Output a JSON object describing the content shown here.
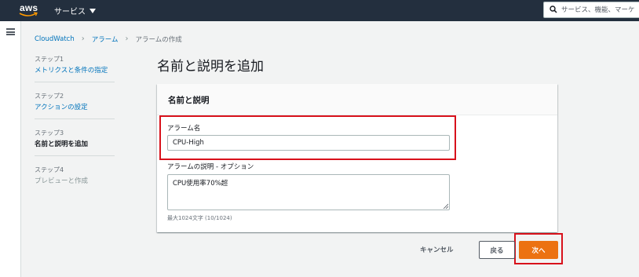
{
  "topnav": {
    "logo_text": "aws",
    "services_label": "サービス",
    "search_placeholder": "サービス、機能、マーケ"
  },
  "breadcrumb": [
    "CloudWatch",
    "アラーム",
    "アラームの作成"
  ],
  "steps": [
    {
      "num": "ステップ1",
      "label": "メトリクスと条件の指定",
      "state": "link"
    },
    {
      "num": "ステップ2",
      "label": "アクションの設定",
      "state": "link"
    },
    {
      "num": "ステップ3",
      "label": "名前と説明を追加",
      "state": "current"
    },
    {
      "num": "ステップ4",
      "label": "プレビューと作成",
      "state": "disabled"
    }
  ],
  "page_title": "名前と説明を追加",
  "panel": {
    "title": "名前と説明",
    "name_label": "アラーム名",
    "name_value": "CPU-High",
    "desc_label": "アラームの説明 - オプション",
    "desc_value": "CPU使用率70%超",
    "desc_hint": "最大1024文字 (10/1024)"
  },
  "footer": {
    "cancel_label": "キャンセル",
    "back_label": "戻る",
    "next_label": "次へ"
  },
  "colors": {
    "nav_bg": "#232f3e",
    "link": "#0073bb",
    "primary": "#ec7211",
    "highlight": "#d8111b"
  }
}
